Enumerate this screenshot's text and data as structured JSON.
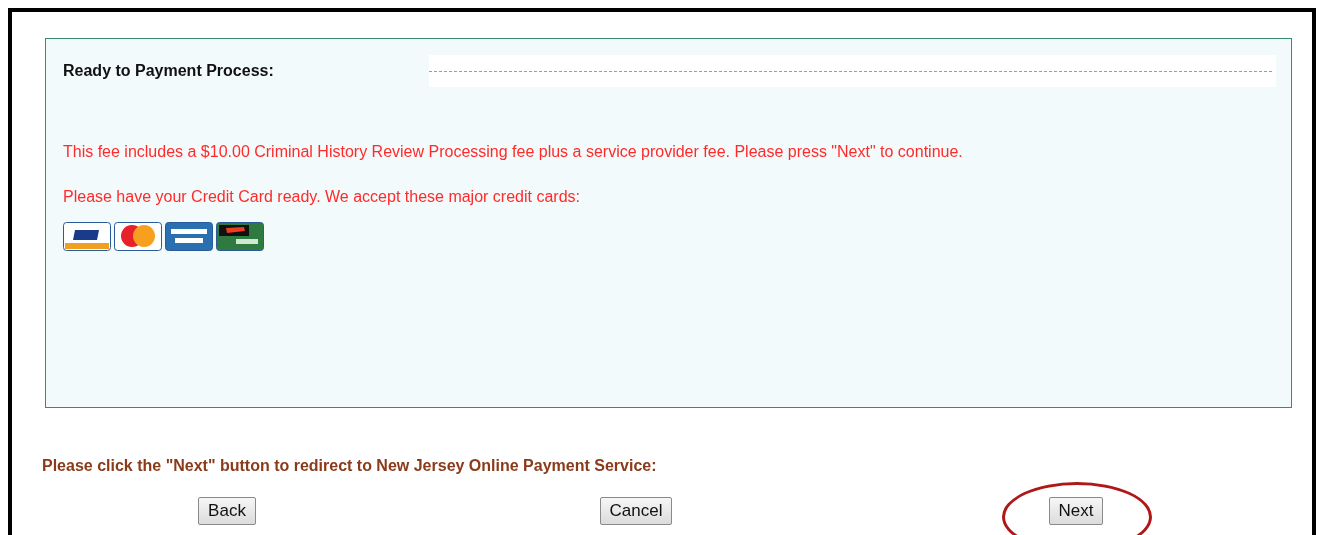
{
  "panel": {
    "title": "Ready to Payment Process:",
    "messages": [
      "This fee includes a $10.00 Criminal History Review Processing fee plus a service provider fee. Please press \"Next\" to continue.",
      "Please have your Credit Card ready. We accept these major credit cards:"
    ],
    "cards": [
      {
        "kind": "visa"
      },
      {
        "kind": "mastercard"
      },
      {
        "kind": "amex"
      },
      {
        "kind": "discover"
      }
    ]
  },
  "instruction": "Please click the \"Next\" button to redirect to New Jersey Online Payment Service:",
  "buttons": [
    {
      "label": "Back",
      "circled": false
    },
    {
      "label": "Cancel",
      "circled": false
    },
    {
      "label": "Next",
      "circled": true
    }
  ]
}
